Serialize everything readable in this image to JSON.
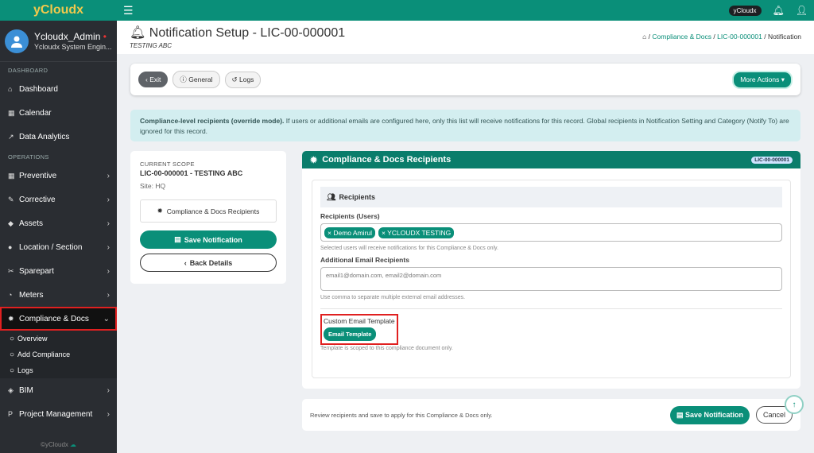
{
  "sidebar": {
    "brand": "yCloudx",
    "user_name": "Ycloudx_Admin",
    "user_role": "Ycloudx System Engin...",
    "sections": {
      "dashboard": "DASHBOARD",
      "operations": "OPERATIONS"
    },
    "items": [
      {
        "label": "Dashboard",
        "icon": "home-icon"
      },
      {
        "label": "Calendar",
        "icon": "calendar-icon"
      },
      {
        "label": "Data Analytics",
        "icon": "chart-icon"
      },
      {
        "label": "Preventive",
        "icon": "calendar-check-icon"
      },
      {
        "label": "Corrective",
        "icon": "wrench-icon"
      },
      {
        "label": "Assets",
        "icon": "tag-icon"
      },
      {
        "label": "Location / Section",
        "icon": "globe-icon"
      },
      {
        "label": "Sparepart",
        "icon": "tools-icon"
      },
      {
        "label": "Meters",
        "icon": "gauge-icon"
      },
      {
        "label": "Compliance & Docs",
        "icon": "gear-icon"
      },
      {
        "label": "BIM",
        "icon": "cube-icon"
      },
      {
        "label": "Project Management",
        "icon": "project-icon"
      }
    ],
    "subitems": [
      "Overview",
      "Add Compliance",
      "Logs"
    ],
    "footer": "©yCloudx"
  },
  "topbar": {
    "pill": "yCloudx"
  },
  "header": {
    "title": "Notification Setup - LIC-00-000001",
    "subtitle": "TESTING ABC",
    "breadcrumb": [
      "Compliance & Docs",
      "LIC-00-000001",
      "Notification"
    ]
  },
  "toolbar": {
    "exit": "Exit",
    "general": "General",
    "logs": "Logs",
    "more_actions": "More Actions"
  },
  "info": {
    "bold": "Compliance-level recipients (override mode).",
    "text": " If users or additional emails are configured here, only this list will receive notifications for this record. Global recipients in Notification Setting and Category (Notify To) are ignored for this record."
  },
  "scope": {
    "label": "CURRENT SCOPE",
    "value": "LIC-00-000001 - TESTING ABC",
    "site": "Site: HQ",
    "recipients_link": "Compliance & Docs Recipients",
    "save": "Save Notification",
    "back": "Back Details"
  },
  "recipients_card": {
    "title": "Compliance & Docs Recipients",
    "tag": "LIC-00-000001",
    "section": "Recipients",
    "users_label": "Recipients (Users)",
    "users": [
      "Demo Amirul",
      "YCLOUDX TESTING"
    ],
    "users_help": "Selected users will receive notifications for this Compliance & Docs only.",
    "emails_label": "Additional Email Recipients",
    "emails_placeholder": "email1@domain.com, email2@domain.com",
    "emails_help": "Use comma to separate multiple external email addresses.",
    "template_label": "Custom Email Template",
    "template_button": "Email Template",
    "template_help": "Template is scoped to this compliance document only."
  },
  "bottom": {
    "text": "Review recipients and save to apply for this Compliance & Docs only.",
    "save": "Save Notification",
    "cancel": "Cancel"
  }
}
